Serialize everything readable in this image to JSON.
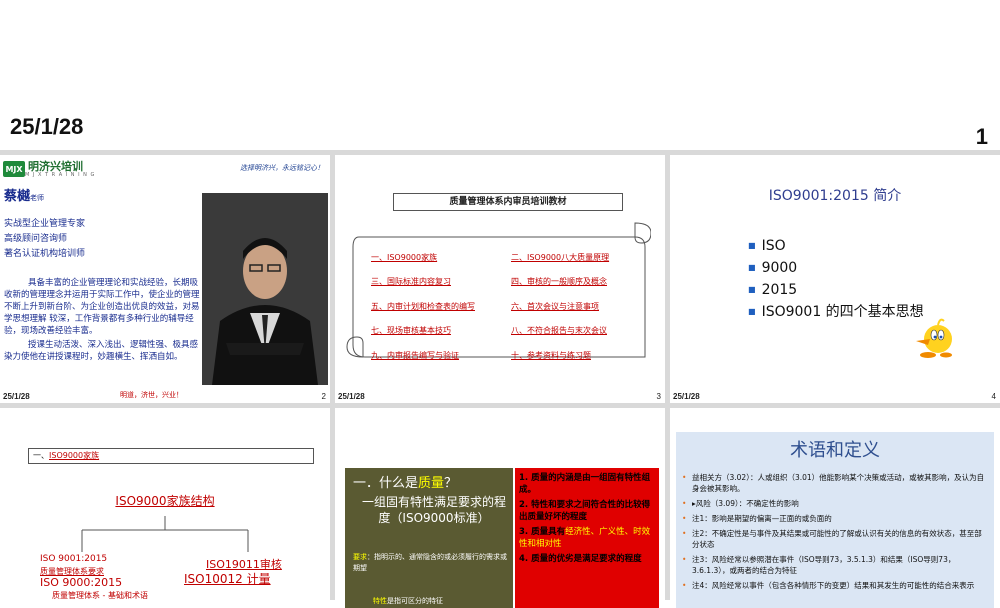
{
  "header": {
    "date": "25/1/28",
    "page_number": "1"
  },
  "slides": [
    {
      "date": "25/1/28",
      "number": "2",
      "logo_mark": "MJX",
      "logo_text": "明济兴培训",
      "logo_sub": "M J X  T R A I N I N G",
      "slogan": "选择明济兴，永远铭记心！",
      "name": "蔡樾",
      "name_suffix": "老师",
      "titles": [
        "实战型企业管理专家",
        "高级顾问咨询师",
        "著名认证机构培训师"
      ],
      "bio": [
        "具备丰富的企业管理理论和实战经验，长期吸收新的管理理念并运用于实际工作中，使企业的管理不断上升到新台阶、为企业创造出优良的效益，对易学思想理解 较深，工作背景都有多种行业的辅导经验，现场改善经验丰富。",
        "授课生动活泼、深入浅出、逻辑性强、极具感染力使他在讲授课程时，妙趣横生、挥洒自如。"
      ],
      "footer_slogan": "明道，济世，兴业！"
    },
    {
      "date": "25/1/28",
      "number": "3",
      "title": "质量管理体系内审员培训教材",
      "toc": [
        [
          "一、ISO9000家族",
          "二、ISO9000八大质量原理"
        ],
        [
          "三、国际标准内容复习",
          "四、审核的一般顺序及概念"
        ],
        [
          "五、内审计划和检查表的编写",
          "六、首次会议与注意事项"
        ],
        [
          "七、现场审核基本技巧",
          "八、不符合报告与末次会议"
        ],
        [
          "九、内审报告编写与验证",
          "十、参考资料与练习题"
        ]
      ]
    },
    {
      "date": "25/1/28",
      "number": "4",
      "title": "ISO9001:2015 简介",
      "items": [
        "ISO",
        "9000",
        "2015",
        "ISO9001 的四个基本思想"
      ]
    },
    {
      "section_prefix": "一、",
      "section_link": "ISO9000家族",
      "family_title": "ISO9000家族结构",
      "left_1": "ISO  9001:2015",
      "left_2": "质量管理体系要求",
      "left_3": "ISO 9000:2015",
      "left_4": "质量管理体系  -  基础和术语",
      "right_1": "ISO19011审核",
      "right_2": "ISO10012 计量"
    },
    {
      "heading_prefix": "一．什么是",
      "heading_keyword": "质量",
      "heading_suffix": "？",
      "definition": "一组固有特性满足要求的程度（ISO9000标准）",
      "note_keyword": "要求",
      "note_text": "：指明示的、通常隐含的或必须履行的需求或期望",
      "note2_keyword": "特性",
      "note2_text": "是指可区分的特征",
      "points": [
        "1. 质量的内涵是由一组固有特性组成。",
        "2. 特性和要求之间符合性的比较得出质量好坏的程度",
        "4. 质量的优劣是满足要求的程度"
      ],
      "point3_prefix": "3. 质量具有",
      "point3_terms": "经济性、广义性、时效性和相对性"
    },
    {
      "title": "术语和定义",
      "items": [
        "益相关方（3.02）：人或组织（3.01）他能影响某个决策或活动，或被其影响，及认为自身会被其影响。",
        "▸风险（3.09）：不确定性的影响",
        "注1：影响是期望的偏离—正面的或负面的",
        "注2：不确定性是与事件及其结果或可能性的了解或认识有关的信息的有效状态，甚至部分状态",
        "注3：风险经常以参照潜在事件（ISO导则73，3.5.1.3）和结果（ISO导则73，3.6.1.3），或两者的结合为特征",
        "注4：风险经常以事件（包含各种情形下的变更）结果和其发生的可能性的结合来表示"
      ]
    }
  ],
  "colors": {
    "accent_red": "#c00000",
    "navy": "#1a2d8f",
    "bullet_blue": "#1f5fbf"
  }
}
